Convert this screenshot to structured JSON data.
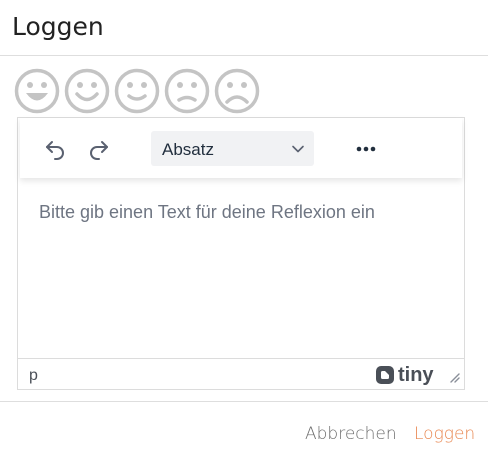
{
  "dialog": {
    "title": "Loggen"
  },
  "moods": [
    {
      "name": "very-happy-face-icon"
    },
    {
      "name": "happy-face-icon"
    },
    {
      "name": "slightly-smiling-face-icon"
    },
    {
      "name": "slightly-frowning-face-icon"
    },
    {
      "name": "sad-face-icon"
    }
  ],
  "editor": {
    "toolbar": {
      "undo_icon": "undo-icon",
      "redo_icon": "redo-icon",
      "blocks_value": "Absatz",
      "more_icon": "more-horizontal-icon"
    },
    "placeholder": "Bitte gib einen Text für deine Reflexion ein",
    "statusbar": {
      "path": "p",
      "brand": "tiny"
    }
  },
  "footer": {
    "cancel_label": "Abbrechen",
    "submit_label": "Loggen"
  },
  "colors": {
    "accent": "#e8864f",
    "mood_icon": "#c4c4c4",
    "divider": "#dedede"
  }
}
